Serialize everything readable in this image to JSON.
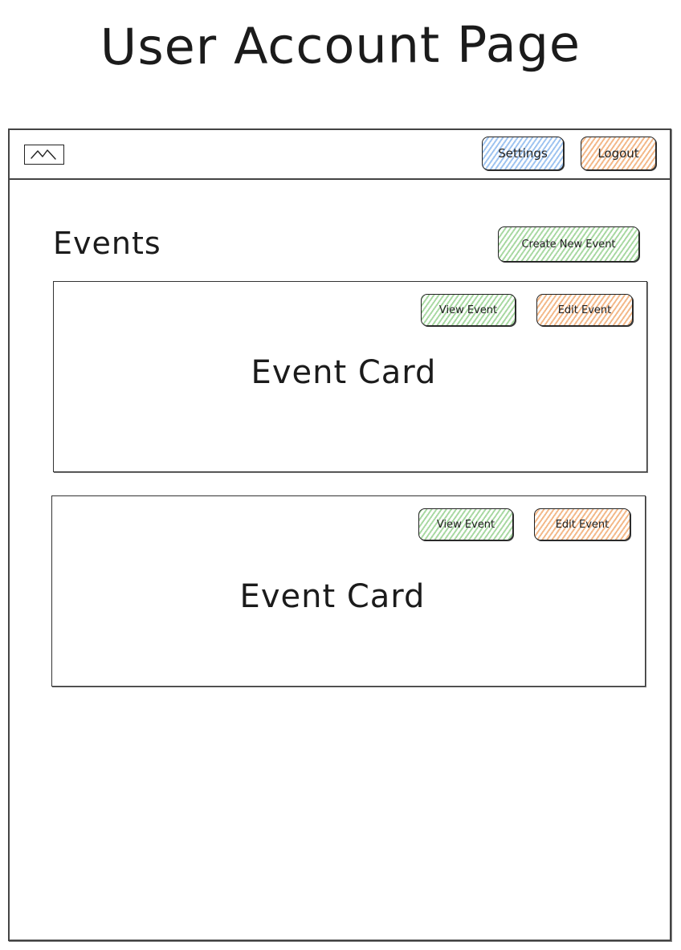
{
  "page": {
    "title": "User Account Page"
  },
  "header": {
    "logo_icon": "image-placeholder-icon",
    "settings_label": "Settings",
    "logout_label": "Logout"
  },
  "events": {
    "heading": "Events",
    "create_label": "Create New Event",
    "cards": [
      {
        "title": "Event Card",
        "view_label": "View Event",
        "edit_label": "Edit Event"
      },
      {
        "title": "Event Card",
        "view_label": "View Event",
        "edit_label": "Edit Event"
      }
    ]
  },
  "colors": {
    "settings": "#9fc4f0",
    "logout": "#f3b98a",
    "create": "#a9d9a3",
    "view": "#a9d9a3",
    "edit": "#f3b98a"
  }
}
